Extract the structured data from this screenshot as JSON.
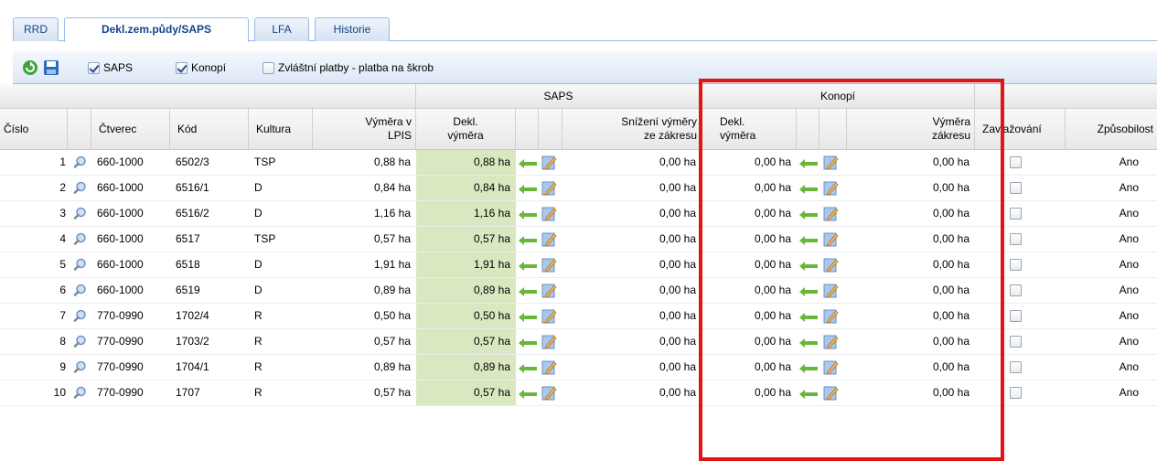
{
  "tabs": [
    {
      "label": "RRD"
    },
    {
      "label": "Dekl.zem.půdy/SAPS"
    },
    {
      "label": "LFA"
    },
    {
      "label": "Historie"
    }
  ],
  "toolbar": {
    "checkboxes": [
      {
        "label": "SAPS",
        "checked": true
      },
      {
        "label": "Konopí",
        "checked": true
      },
      {
        "label": "Zvláštní platby - platba na škrob",
        "checked": false
      }
    ]
  },
  "grid": {
    "group_headers": {
      "saps": "SAPS",
      "konopi": "Konopí"
    },
    "columns": {
      "cislo": "Číslo",
      "ctverec": "Čtverec",
      "kod": "Kód",
      "kultura": "Kultura",
      "vymera_lpis_1": "Výměra v",
      "vymera_lpis_2": "LPIS",
      "saps_dekl_1": "Dekl.",
      "saps_dekl_2": "výměra",
      "snizeni_1": "Snížení výměry",
      "snizeni_2": "ze zákresu",
      "konopi_dekl_1": "Dekl.",
      "konopi_dekl_2": "výměra",
      "vymera_zakresu_1": "Výměra",
      "vymera_zakresu_2": "zákresu",
      "zavlazovani": "Zavlažování",
      "zpusobilost": "Způsobilost"
    },
    "rows": [
      {
        "cislo": "1",
        "ctverec": "660-1000",
        "kod": "6502/3",
        "kultura": "TSP",
        "lpis": "0,88 ha",
        "saps": "0,88 ha",
        "snizeni": "0,00 ha",
        "konopi": "0,00 ha",
        "zakres": "0,00 ha",
        "zpusobilost": "Ano"
      },
      {
        "cislo": "2",
        "ctverec": "660-1000",
        "kod": "6516/1",
        "kultura": "D",
        "lpis": "0,84 ha",
        "saps": "0,84 ha",
        "snizeni": "0,00 ha",
        "konopi": "0,00 ha",
        "zakres": "0,00 ha",
        "zpusobilost": "Ano"
      },
      {
        "cislo": "3",
        "ctverec": "660-1000",
        "kod": "6516/2",
        "kultura": "D",
        "lpis": "1,16 ha",
        "saps": "1,16 ha",
        "snizeni": "0,00 ha",
        "konopi": "0,00 ha",
        "zakres": "0,00 ha",
        "zpusobilost": "Ano"
      },
      {
        "cislo": "4",
        "ctverec": "660-1000",
        "kod": "6517",
        "kultura": "TSP",
        "lpis": "0,57 ha",
        "saps": "0,57 ha",
        "snizeni": "0,00 ha",
        "konopi": "0,00 ha",
        "zakres": "0,00 ha",
        "zpusobilost": "Ano"
      },
      {
        "cislo": "5",
        "ctverec": "660-1000",
        "kod": "6518",
        "kultura": "D",
        "lpis": "1,91 ha",
        "saps": "1,91 ha",
        "snizeni": "0,00 ha",
        "konopi": "0,00 ha",
        "zakres": "0,00 ha",
        "zpusobilost": "Ano"
      },
      {
        "cislo": "6",
        "ctverec": "660-1000",
        "kod": "6519",
        "kultura": "D",
        "lpis": "0,89 ha",
        "saps": "0,89 ha",
        "snizeni": "0,00 ha",
        "konopi": "0,00 ha",
        "zakres": "0,00 ha",
        "zpusobilost": "Ano"
      },
      {
        "cislo": "7",
        "ctverec": "770-0990",
        "kod": "1702/4",
        "kultura": "R",
        "lpis": "0,50 ha",
        "saps": "0,50 ha",
        "snizeni": "0,00 ha",
        "konopi": "0,00 ha",
        "zakres": "0,00 ha",
        "zpusobilost": "Ano"
      },
      {
        "cislo": "8",
        "ctverec": "770-0990",
        "kod": "1703/2",
        "kultura": "R",
        "lpis": "0,57 ha",
        "saps": "0,57 ha",
        "snizeni": "0,00 ha",
        "konopi": "0,00 ha",
        "zakres": "0,00 ha",
        "zpusobilost": "Ano"
      },
      {
        "cislo": "9",
        "ctverec": "770-0990",
        "kod": "1704/1",
        "kultura": "R",
        "lpis": "0,89 ha",
        "saps": "0,89 ha",
        "snizeni": "0,00 ha",
        "konopi": "0,00 ha",
        "zakres": "0,00 ha",
        "zpusobilost": "Ano"
      },
      {
        "cislo": "10",
        "ctverec": "770-0990",
        "kod": "1707",
        "kultura": "R",
        "lpis": "0,57 ha",
        "saps": "0,57 ha",
        "snizeni": "0,00 ha",
        "konopi": "0,00 ha",
        "zakres": "0,00 ha",
        "zpusobilost": "Ano"
      }
    ]
  },
  "colors": {
    "highlight": "#e31414",
    "declared_cell": "#d9e8c0",
    "tab_text": "#15428b"
  }
}
